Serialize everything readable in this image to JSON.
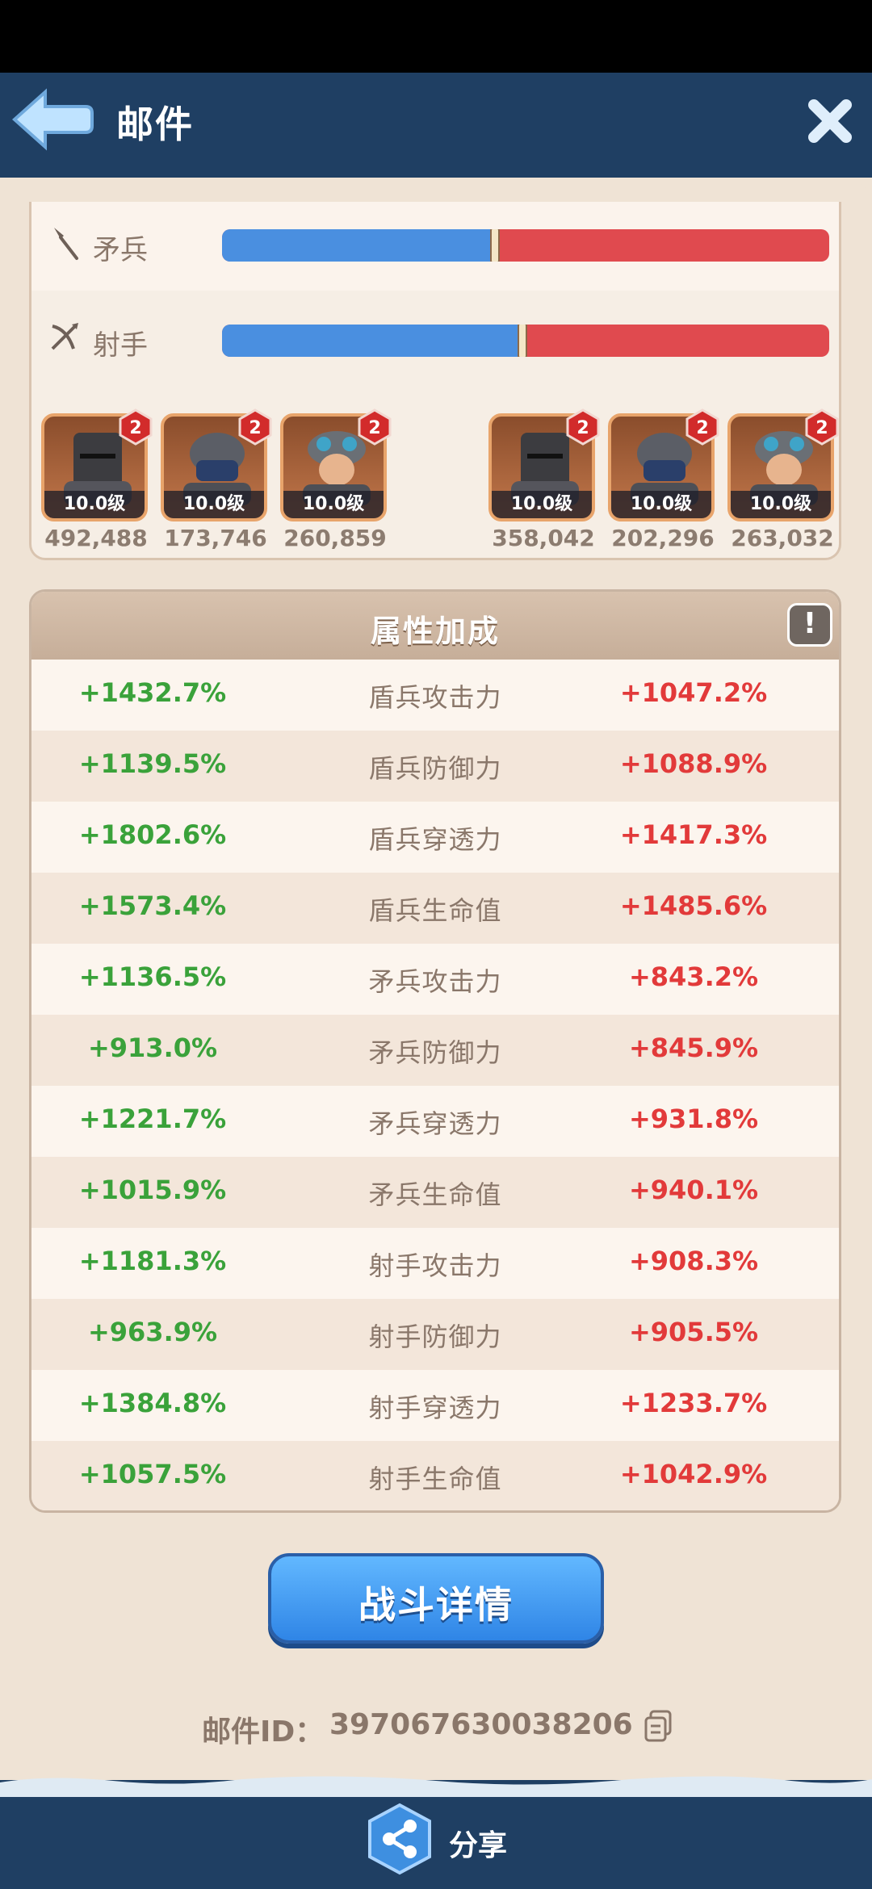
{
  "header": {
    "title": "邮件",
    "back_icon": "back-arrow-icon",
    "close_icon": "close-icon"
  },
  "troop_ratios": [
    {
      "label": "矛兵",
      "icon": "spear-icon",
      "blue_share": 0.45
    },
    {
      "label": "射手",
      "icon": "crossbow-icon",
      "blue_share": 0.495
    }
  ],
  "heroes": {
    "left": [
      {
        "level": "10.0级",
        "power": "492,488",
        "badge": "2",
        "portrait": "iron-helmet-knight"
      },
      {
        "level": "10.0级",
        "power": "173,746",
        "badge": "2",
        "portrait": "masked-soldier"
      },
      {
        "level": "10.0级",
        "power": "260,859",
        "badge": "2",
        "portrait": "goggles-soldier"
      }
    ],
    "right": [
      {
        "level": "10.0级",
        "power": "358,042",
        "badge": "2",
        "portrait": "iron-helmet-knight"
      },
      {
        "level": "10.0级",
        "power": "202,296",
        "badge": "2",
        "portrait": "masked-soldier"
      },
      {
        "level": "10.0级",
        "power": "263,032",
        "badge": "2",
        "portrait": "goggles-soldier"
      }
    ]
  },
  "attributes": {
    "title": "属性加成",
    "info_label": "!",
    "rows": [
      {
        "left": "+1432.7%",
        "name": "盾兵攻击力",
        "right": "+1047.2%"
      },
      {
        "left": "+1139.5%",
        "name": "盾兵防御力",
        "right": "+1088.9%"
      },
      {
        "left": "+1802.6%",
        "name": "盾兵穿透力",
        "right": "+1417.3%"
      },
      {
        "left": "+1573.4%",
        "name": "盾兵生命值",
        "right": "+1485.6%"
      },
      {
        "left": "+1136.5%",
        "name": "矛兵攻击力",
        "right": "+843.2%"
      },
      {
        "left": "+913.0%",
        "name": "矛兵防御力",
        "right": "+845.9%"
      },
      {
        "left": "+1221.7%",
        "name": "矛兵穿透力",
        "right": "+931.8%"
      },
      {
        "left": "+1015.9%",
        "name": "矛兵生命值",
        "right": "+940.1%"
      },
      {
        "left": "+1181.3%",
        "name": "射手攻击力",
        "right": "+908.3%"
      },
      {
        "left": "+963.9%",
        "name": "射手防御力",
        "right": "+905.5%"
      },
      {
        "left": "+1384.8%",
        "name": "射手穿透力",
        "right": "+1233.7%"
      },
      {
        "left": "+1057.5%",
        "name": "射手生命值",
        "right": "+1042.9%"
      }
    ]
  },
  "battle_detail_button": "战斗详情",
  "mail_id": {
    "label": "邮件ID：",
    "value": "397067630038206",
    "copy_icon": "copy-icon"
  },
  "footer": {
    "share_label": "分享",
    "share_icon": "share-icon"
  },
  "colors": {
    "blue_side": "#4a8fe0",
    "red_side": "#e04a4f",
    "positive_green": "#3aa23a",
    "enemy_red": "#e23a3a",
    "frame_navy": "#1f3f63"
  }
}
